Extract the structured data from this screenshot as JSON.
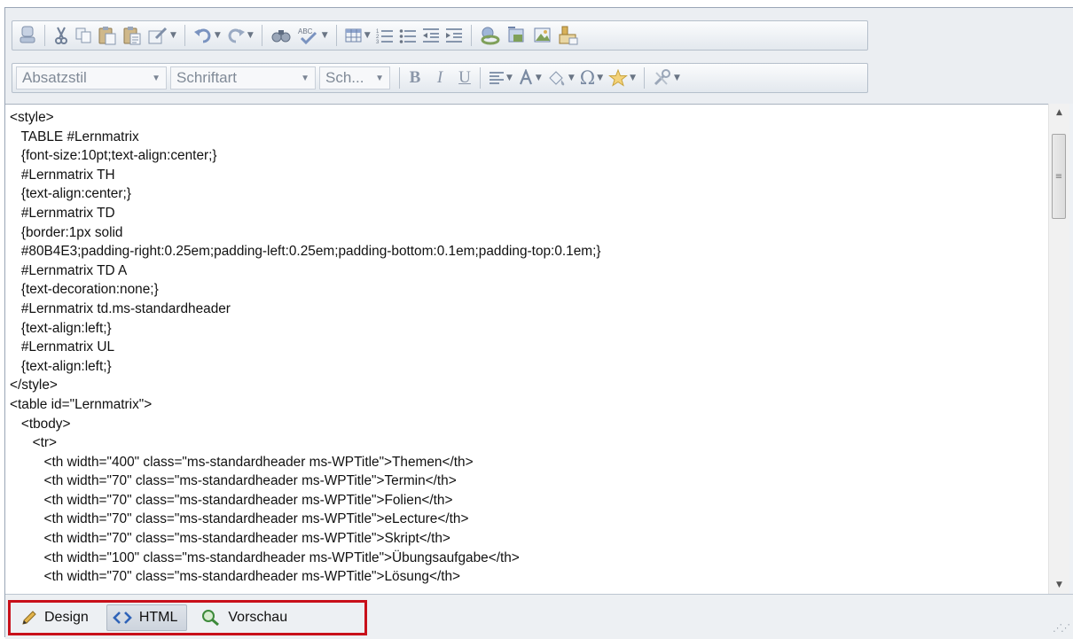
{
  "toolbar": {
    "row1_icons": [
      "save-icon",
      "cut-icon",
      "copy-icon",
      "paste-icon",
      "paste-text-icon",
      "format-painter-icon",
      "undo-icon",
      "redo-icon",
      "find-icon",
      "spellcheck-icon",
      "insert-table-icon",
      "numbered-list-icon",
      "bulleted-list-icon",
      "outdent-icon",
      "indent-icon",
      "insert-link-icon",
      "insert-web-part-icon",
      "insert-image-icon",
      "insert-reusable-content-icon"
    ],
    "paragraph_style": "Absatzstil",
    "font_family": "Schriftart",
    "font_size": "Sch...",
    "bold": "B",
    "italic": "I",
    "underline": "U"
  },
  "editor": {
    "code_lines": [
      "<style>",
      "   TABLE #Lernmatrix",
      "   {font-size:10pt;text-align:center;}",
      "   #Lernmatrix TH",
      "   {text-align:center;}",
      "   #Lernmatrix TD",
      "   {border:1px solid",
      "   #80B4E3;padding-right:0.25em;padding-left:0.25em;padding-bottom:0.1em;padding-top:0.1em;}",
      "   #Lernmatrix TD A",
      "   {text-decoration:none;}",
      "   #Lernmatrix td.ms-standardheader",
      "   {text-align:left;}",
      "   #Lernmatrix UL",
      "   {text-align:left;}",
      "</style>",
      "<table id=\"Lernmatrix\">",
      "   <tbody>",
      "      <tr>",
      "         <th width=\"400\" class=\"ms-standardheader ms-WPTitle\">Themen</th>",
      "         <th width=\"70\" class=\"ms-standardheader ms-WPTitle\">Termin</th>",
      "         <th width=\"70\" class=\"ms-standardheader ms-WPTitle\">Folien</th>",
      "         <th width=\"70\" class=\"ms-standardheader ms-WPTitle\">eLecture</th>",
      "         <th width=\"70\" class=\"ms-standardheader ms-WPTitle\">Skript</th>",
      "         <th width=\"100\" class=\"ms-standardheader ms-WPTitle\">Übungsaufgabe</th>",
      "         <th width=\"70\" class=\"ms-standardheader ms-WPTitle\">Lösung</th>"
    ]
  },
  "tabs": {
    "design": "Design",
    "html": "HTML",
    "preview": "Vorschau"
  },
  "colors": {
    "highlight_border": "#c8101a",
    "toolbar_icon": "#6b7b92"
  }
}
